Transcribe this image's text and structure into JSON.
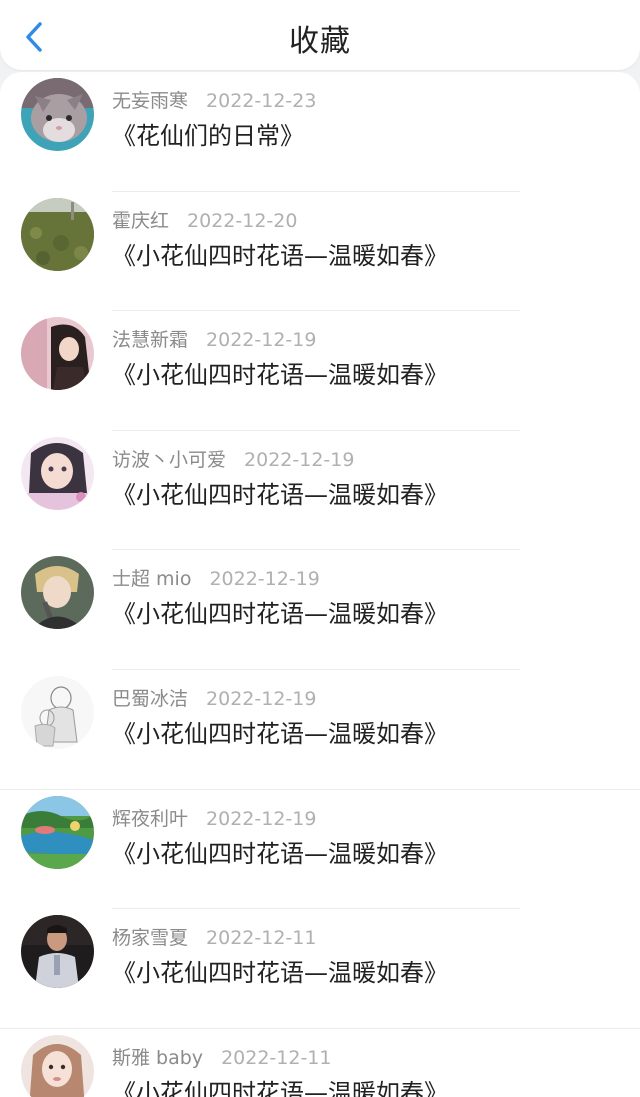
{
  "header": {
    "title": "收藏",
    "back_icon": "chevron-left-icon"
  },
  "colors": {
    "accent": "#2f8be6",
    "background": "#f1f2f4",
    "card": "#ffffff"
  },
  "items": [
    {
      "name": "无妄雨寒",
      "date": "2022-12-23",
      "title": "《花仙们的日常》",
      "avatar": "cat-photo"
    },
    {
      "name": "霍庆红",
      "date": "2022-12-20",
      "title": "《小花仙四时花语—温暖如春》",
      "avatar": "grass-field-photo"
    },
    {
      "name": "法慧新霜",
      "date": "2022-12-19",
      "title": "《小花仙四时花语—温暖如春》",
      "avatar": "anime-girl-illustration"
    },
    {
      "name": "访波丶小可爱",
      "date": "2022-12-19",
      "title": "《小花仙四时花语—温暖如春》",
      "avatar": "girl-portrait"
    },
    {
      "name": "士超 mio",
      "date": "2022-12-19",
      "title": "《小花仙四时花语—温暖如春》",
      "avatar": "singer-portrait"
    },
    {
      "name": "巴蜀冰洁",
      "date": "2022-12-19",
      "title": "《小花仙四时花语—温暖如春》",
      "avatar": "sketch-drawing"
    },
    {
      "name": "辉夜利叶",
      "date": "2022-12-19",
      "title": "《小花仙四时花语—温暖如春》",
      "avatar": "landscape-illustration"
    },
    {
      "name": "杨家雪夏",
      "date": "2022-12-11",
      "title": "《小花仙四时花语—温暖如春》",
      "avatar": "man-portrait"
    },
    {
      "name": "斯雅 baby",
      "date": "2022-12-11",
      "title": "《小花仙四时花语—温暖如春》",
      "avatar": "woman-portrait"
    }
  ]
}
